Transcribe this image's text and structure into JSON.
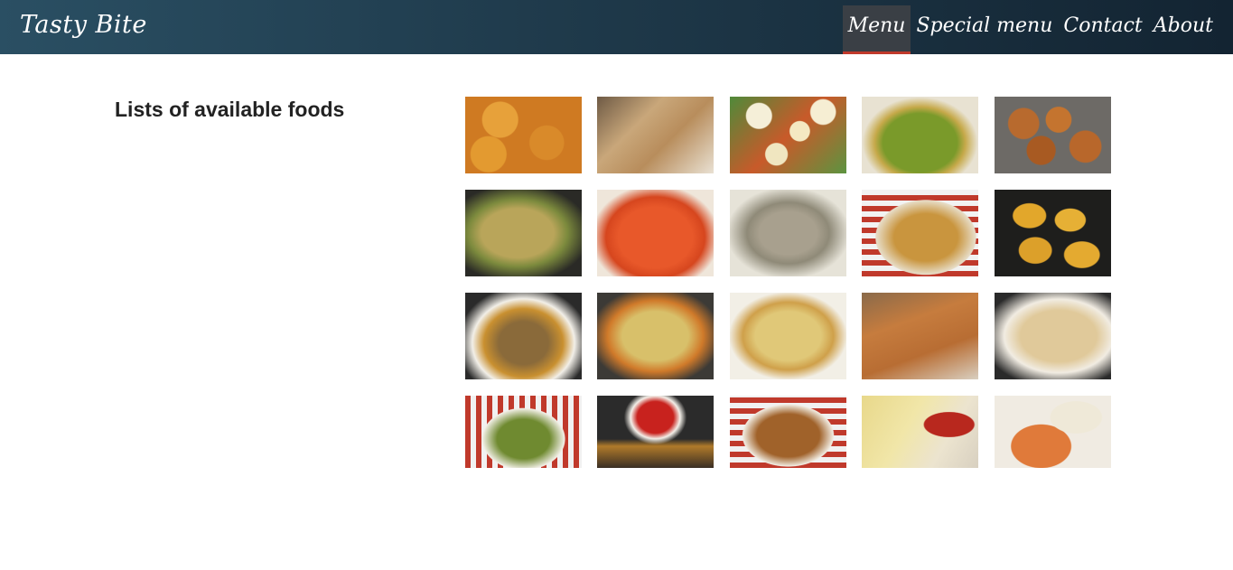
{
  "header": {
    "brand": "Tasty Bite",
    "nav": [
      {
        "label": "Menu",
        "active": true
      },
      {
        "label": "Special menu",
        "active": false
      },
      {
        "label": "Contact",
        "active": false
      },
      {
        "label": "About",
        "active": false
      }
    ]
  },
  "main": {
    "title": "Lists of available foods"
  },
  "colors": {
    "header_left": "#2a4f63",
    "header_right": "#132432",
    "active_tab": "#3a3f45",
    "active_underline": "#c0392b"
  }
}
